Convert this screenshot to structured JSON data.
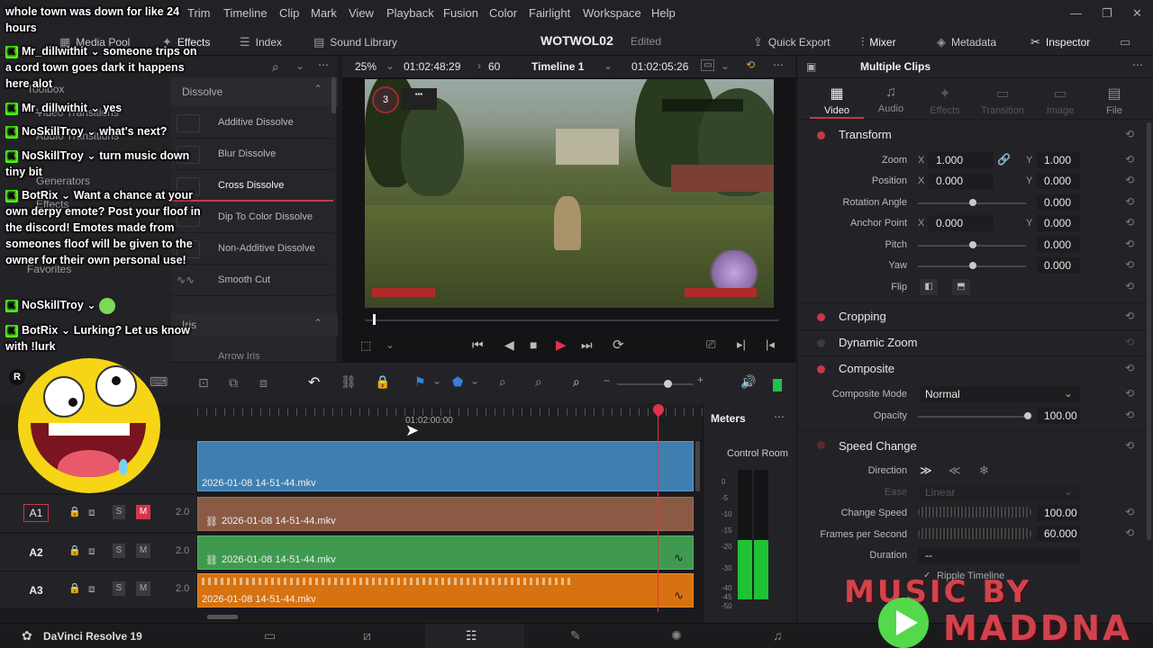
{
  "menubar": {
    "items": [
      "Trim",
      "Timeline",
      "Clip",
      "Mark",
      "View",
      "Playback",
      "Fusion",
      "Color",
      "Fairlight",
      "Workspace",
      "Help"
    ]
  },
  "toolbar": {
    "media_pool": "Media Pool",
    "effects": "Effects",
    "index": "Index",
    "sound_library": "Sound Library",
    "project_title": "WOTWOL02",
    "edited_status": "Edited",
    "quick_export": "Quick Export",
    "mixer": "Mixer",
    "metadata": "Metadata",
    "inspector": "Inspector"
  },
  "viewer": {
    "zoom": "25%",
    "timecode": "01:02:48:29",
    "fps_marker": "60",
    "timeline_name": "Timeline 1",
    "current_tc": "01:02:05:26"
  },
  "effects_panel": {
    "left_labels": [
      "Toolbox",
      "Video Transitions",
      "Audio Transitions",
      "Generators",
      "Effects",
      "Favorites"
    ],
    "group_title": "Dissolve",
    "items": [
      "Additive Dissolve",
      "Blur Dissolve",
      "Cross Dissolve",
      "Dip To Color Dissolve",
      "Non-Additive Dissolve",
      "Smooth Cut"
    ],
    "group2_title": "Iris",
    "group2_first": "Arrow Iris"
  },
  "inspector": {
    "header": "Multiple Clips",
    "tabs": [
      "Video",
      "Audio",
      "Effects",
      "Transition",
      "Image",
      "File"
    ],
    "transform_title": "Transform",
    "zoom_label": "Zoom",
    "zoom_x": "1.000",
    "zoom_y": "1.000",
    "position_label": "Position",
    "position_x": "0.000",
    "position_y": "0.000",
    "rotation_label": "Rotation Angle",
    "rotation_val": "0.000",
    "anchor_label": "Anchor Point",
    "anchor_x": "0.000",
    "anchor_y": "0.000",
    "pitch_label": "Pitch",
    "pitch_val": "0.000",
    "yaw_label": "Yaw",
    "yaw_val": "0.000",
    "flip_label": "Flip",
    "cropping_title": "Cropping",
    "dynamic_zoom_title": "Dynamic Zoom",
    "composite_title": "Composite",
    "composite_mode_label": "Composite Mode",
    "composite_mode_val": "Normal",
    "opacity_label": "Opacity",
    "opacity_val": "100.00",
    "speed_change_title": "Speed Change",
    "direction_label": "Direction",
    "ease_label": "Ease",
    "ease_val": "Linear",
    "change_speed_label": "Change Speed",
    "change_speed_val": "100.00",
    "fps_label": "Frames per Second",
    "fps_val": "60.000",
    "duration_label": "Duration",
    "duration_val": "--",
    "ripple_label": "Ripple Timeline",
    "axis_x": "X",
    "axis_y": "Y"
  },
  "timeline": {
    "ruler_tc": "01:02:00:00",
    "video_clip": "2026-01-08 14-51-44.mkv",
    "tracks": [
      {
        "id": "A1",
        "level": "2.0",
        "clip": "2026-01-08 14-51-44.mkv"
      },
      {
        "id": "A2",
        "level": "2.0",
        "clip": "2026-01-08 14-51-44.mkv"
      },
      {
        "id": "A3",
        "level": "2.0",
        "clip": "2026-01-08 14-51-44.mkv"
      }
    ],
    "solo": "S",
    "mute": "M"
  },
  "meters": {
    "title": "Meters",
    "control_room": "Control Room",
    "scale": [
      "0",
      "-5",
      "-10",
      "-15",
      "-20",
      "-30",
      "-40",
      "-45",
      "-50"
    ]
  },
  "bottombar": {
    "app_name": "DaVinci Resolve 19"
  },
  "chat": {
    "lines": [
      {
        "user": "",
        "text": "whole town was down for like 24 hours"
      },
      {
        "user": "Mr_dillwithit",
        "text": "someone trips on a cord town goes dark it happens here alot"
      },
      {
        "user": "Mr_dillwithit",
        "text": "yes"
      },
      {
        "user": "NoSkillTroy",
        "text": "what's next?"
      },
      {
        "user": "NoSkillTroy",
        "text": "turn music down tiny bit"
      },
      {
        "user": "BotRix",
        "text": "Want a chance at your own derpy emote? Post your floof in the discord! Emotes made from someones floof will be given to the owner for their own personal use!"
      },
      {
        "user": "NoSkillTroy",
        "text": ""
      },
      {
        "user": "BotRix",
        "text": "Lurking? Let us know with !lurk"
      }
    ]
  },
  "overlay": {
    "music_line1": "MUSIC BY",
    "music_line2": "MADDNA"
  },
  "colors": {
    "accent_red": "#c7384a",
    "video_clip": "#3f7fb0",
    "a1_clip": "#8a5a44",
    "a2_clip": "#3f9a4f",
    "a3_clip": "#d77211",
    "kick_green": "#53fc18"
  }
}
